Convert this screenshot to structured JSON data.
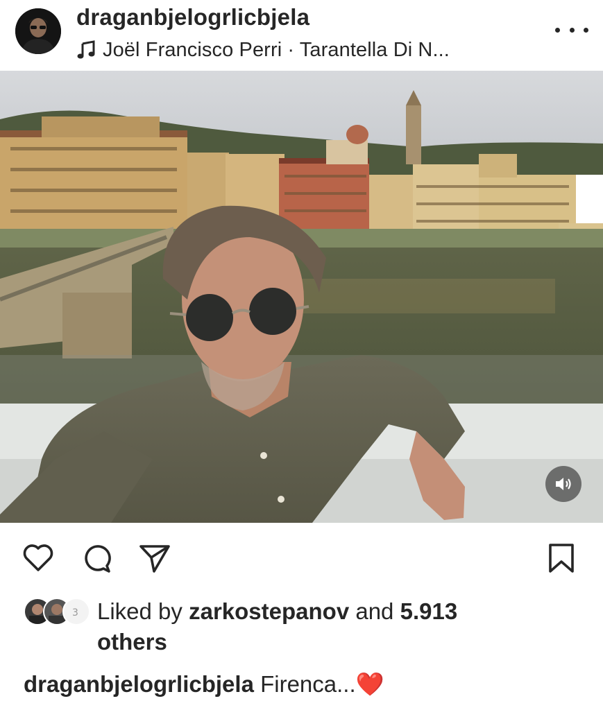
{
  "post": {
    "username": "draganbjelogrlicbjela",
    "music_label": "Joël Francisco Perri · Tarantella Di N...",
    "avatar_icon": "profile-avatar",
    "more_icon": "more-horizontal-icon"
  },
  "photo": {
    "description_icon": "selfie-photo-florence-arno",
    "sound_icon": "speaker-icon"
  },
  "actions": {
    "like_icon": "heart-icon",
    "comment_icon": "comment-bubble-icon",
    "share_icon": "paper-plane-icon",
    "save_icon": "bookmark-icon"
  },
  "likes": {
    "prefix": "Liked by ",
    "user": "zarkostepanov",
    "middle": " and ",
    "count": "5.913",
    "suffix": "others"
  },
  "caption": {
    "user": "draganbjelogrlicbjela",
    "text": " Firenca...",
    "emoji": "❤️"
  },
  "colors": {
    "text": "#262626",
    "background": "#ffffff",
    "heart": "#e0245e"
  }
}
